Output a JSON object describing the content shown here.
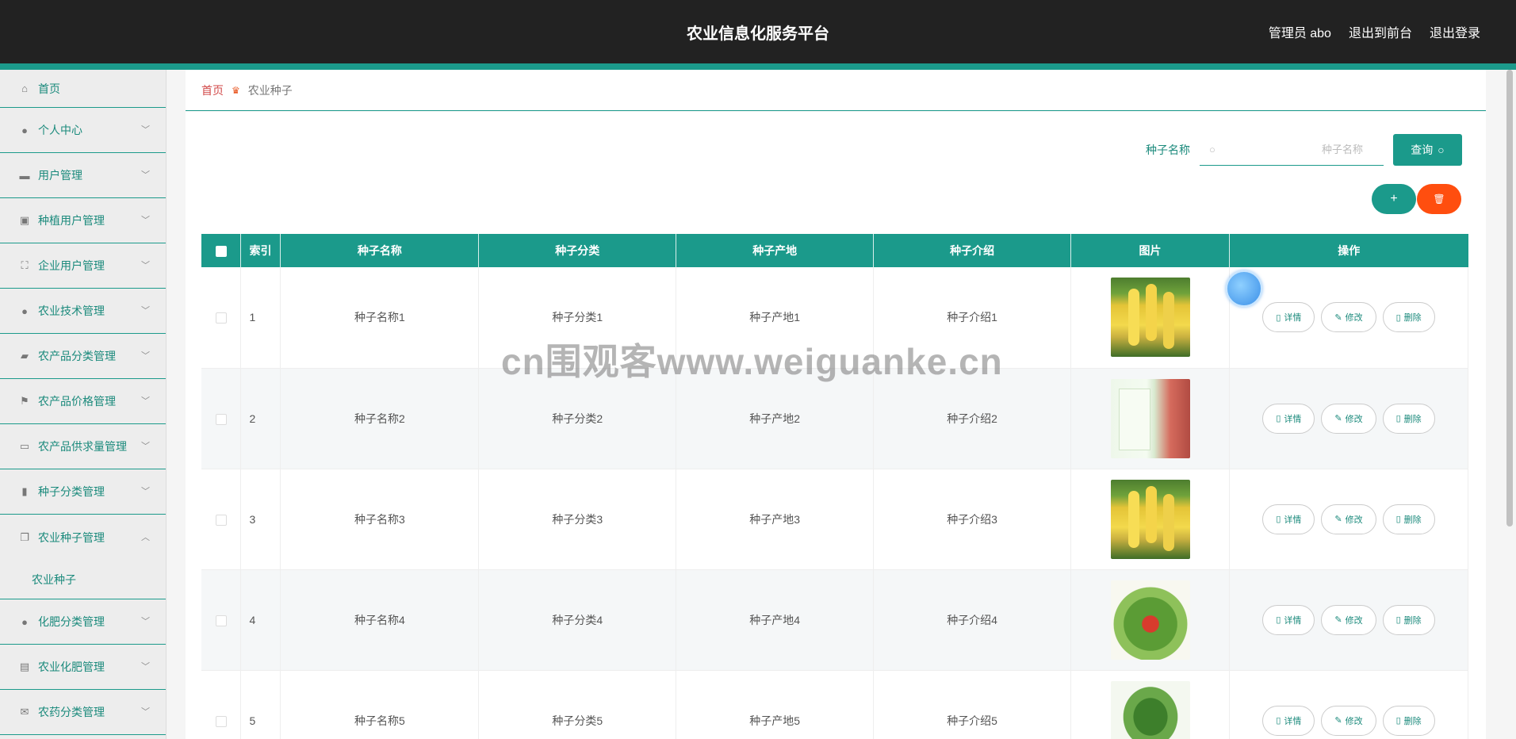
{
  "header": {
    "title": "农业信息化服务平台",
    "user": "管理员 abo",
    "to_front": "退出到前台",
    "logout": "退出登录"
  },
  "sidebar": {
    "items": [
      {
        "label": "首页",
        "icon": "home-icon"
      },
      {
        "label": "个人中心",
        "icon": "user-icon"
      },
      {
        "label": "用户管理",
        "icon": "pin-icon"
      },
      {
        "label": "种植用户管理",
        "icon": "clipboard-icon"
      },
      {
        "label": "企业用户管理",
        "icon": "frame-icon"
      },
      {
        "label": "农业技术管理",
        "icon": "person-icon"
      },
      {
        "label": "农产品分类管理",
        "icon": "print-icon"
      },
      {
        "label": "农产品价格管理",
        "icon": "flag-icon"
      },
      {
        "label": "农产品供求量管理",
        "icon": "chat-icon"
      },
      {
        "label": "种子分类管理",
        "icon": "bar-chart-icon"
      },
      {
        "label": "农业种子管理",
        "icon": "copy-icon",
        "expanded": true,
        "sub": "农业种子"
      },
      {
        "label": "化肥分类管理",
        "icon": "user-icon"
      },
      {
        "label": "农业化肥管理",
        "icon": "id-card-icon"
      },
      {
        "label": "农药分类管理",
        "icon": "mail-icon"
      }
    ]
  },
  "breadcrumb": {
    "home": "首页",
    "current": "农业种子"
  },
  "search": {
    "label": "种子名称",
    "placeholder": "种子名称",
    "button": "查询"
  },
  "actions": {
    "add": "+",
    "delete": "🗑"
  },
  "table": {
    "headers": [
      "索引",
      "种子名称",
      "种子分类",
      "种子产地",
      "种子介绍",
      "图片",
      "操作"
    ],
    "rows": [
      {
        "index": "1",
        "name": "种子名称1",
        "category": "种子分类1",
        "origin": "种子产地1",
        "intro": "种子介绍1",
        "image": "corn"
      },
      {
        "index": "2",
        "name": "种子名称2",
        "category": "种子分类2",
        "origin": "种子产地2",
        "intro": "种子介绍2",
        "image": "pack"
      },
      {
        "index": "3",
        "name": "种子名称3",
        "category": "种子分类3",
        "origin": "种子产地3",
        "intro": "种子介绍3",
        "image": "corn"
      },
      {
        "index": "4",
        "name": "种子名称4",
        "category": "种子分类4",
        "origin": "种子产地4",
        "intro": "种子介绍4",
        "image": "veg"
      },
      {
        "index": "5",
        "name": "种子名称5",
        "category": "种子分类5",
        "origin": "种子产地5",
        "intro": "种子介绍5",
        "image": "greens"
      }
    ],
    "ops": {
      "detail": "详情",
      "edit": "修改",
      "delete": "删除"
    }
  },
  "watermark": "cn围观客www.weiguanke.cn",
  "colors": {
    "accent": "#1b9a8b",
    "danger": "#ff4e0f",
    "header": "#222222"
  }
}
